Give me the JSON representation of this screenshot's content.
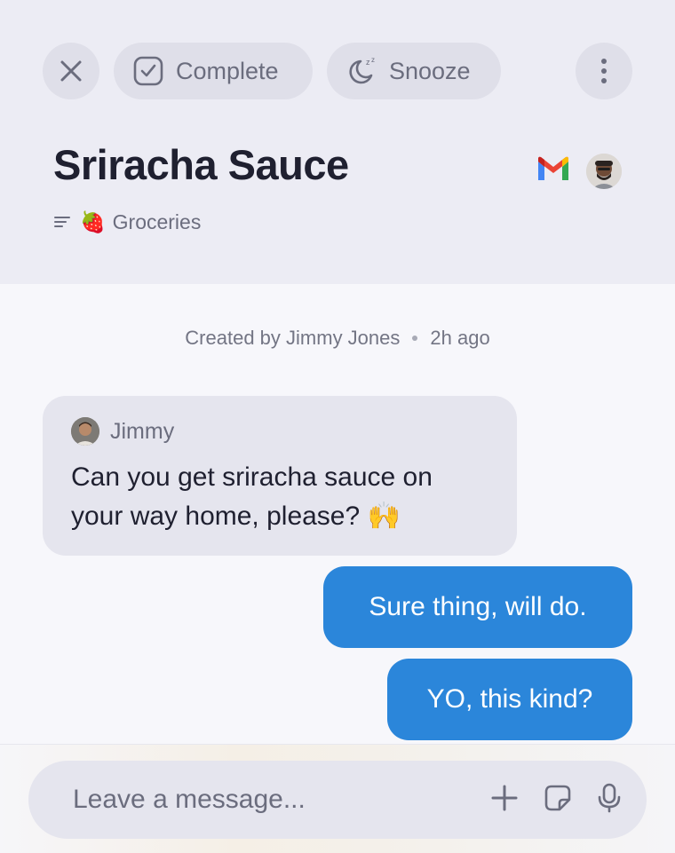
{
  "toolbar": {
    "close_icon": "close-icon",
    "complete_label": "Complete",
    "complete_icon": "check-square-icon",
    "snooze_label": "Snooze",
    "snooze_icon": "moon-zzz-icon",
    "more_icon": "more-vertical-icon"
  },
  "task": {
    "title": "Sriracha Sauce",
    "list_icon": "list-lines-icon",
    "list_emoji": "🍓",
    "list_name": "Groceries"
  },
  "meta": {
    "created_by": "Created by Jimmy Jones",
    "time_ago": "2h ago"
  },
  "messages": [
    {
      "sender": "Jimmy",
      "text": "Can you get sriracha sauce on your way home, please? 🙌",
      "direction": "incoming"
    },
    {
      "text": "Sure thing, will do.",
      "direction": "outgoing"
    },
    {
      "text": "YO, this kind?",
      "direction": "outgoing"
    }
  ],
  "composer": {
    "placeholder": "Leave a message...",
    "value": ""
  },
  "colors": {
    "accent": "#2b86da",
    "header_bg": "#ececf4",
    "bubble_in": "#e5e5ee"
  }
}
